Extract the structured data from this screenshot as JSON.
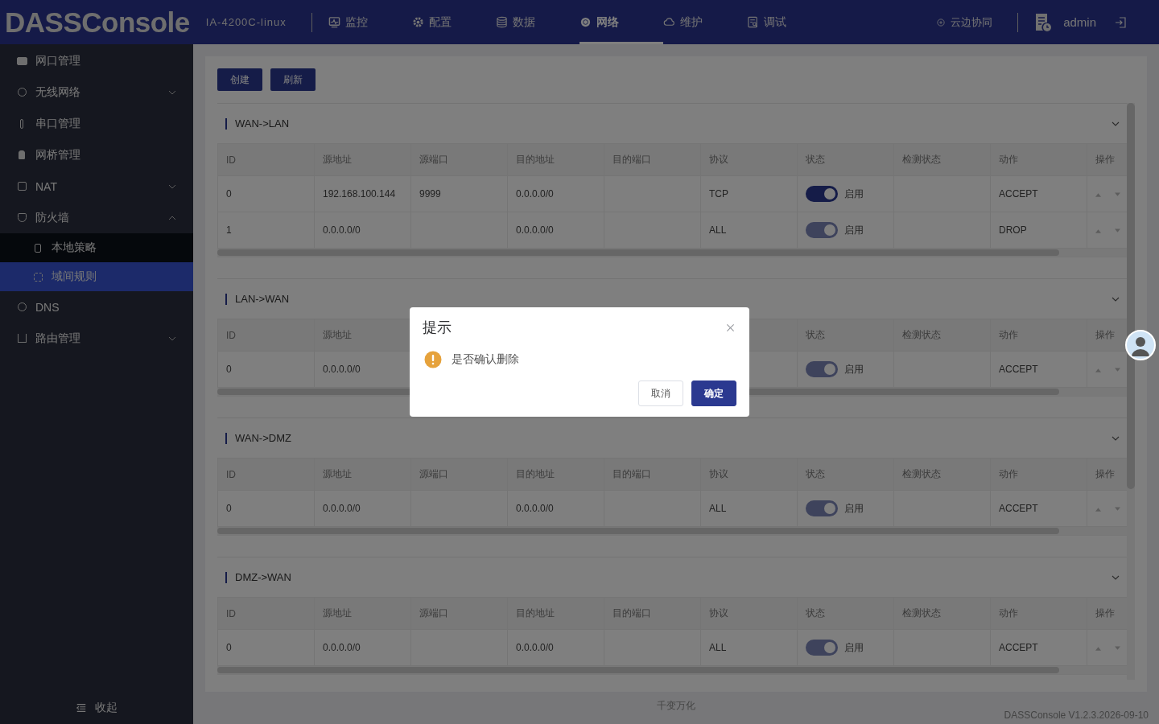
{
  "header": {
    "logo": "DASSConsole",
    "device": "IA-4200C-linux",
    "nav": [
      {
        "label": "监控",
        "selected": false
      },
      {
        "label": "配置",
        "selected": false
      },
      {
        "label": "数据",
        "selected": false
      },
      {
        "label": "网络",
        "selected": true
      },
      {
        "label": "维护",
        "selected": false
      },
      {
        "label": "调试",
        "selected": false
      }
    ],
    "cloud": "云边协同",
    "user": "admin"
  },
  "sidebar": {
    "items": [
      {
        "label": "网口管理",
        "selected": false
      },
      {
        "label": "无线网络",
        "selected": false,
        "expanded": false
      },
      {
        "label": "串口管理",
        "selected": false
      },
      {
        "label": "网桥管理",
        "selected": false
      },
      {
        "label": "NAT",
        "selected": false,
        "expanded": false
      },
      {
        "label": "防火墙",
        "selected": false,
        "expanded": true,
        "children": [
          {
            "label": "本地策略",
            "selected": false
          },
          {
            "label": "域间规则",
            "selected": true
          }
        ]
      },
      {
        "label": "DNS",
        "selected": false
      },
      {
        "label": "路由管理",
        "selected": false,
        "expanded": false
      }
    ],
    "collapse": "收起"
  },
  "toolbar": [
    "创建",
    "刷新"
  ],
  "sections": [
    {
      "title": "WAN->LAN",
      "expanded": true,
      "columns": [
        "ID",
        "源地址",
        "源端口",
        "目的地址",
        "目的端口",
        "协议",
        "状态",
        "检测状态",
        "动作",
        "操作"
      ],
      "rows": [
        {
          "id": "0",
          "src_addr": "192.168.100.144",
          "src_port": "9999",
          "dst_addr": "0.0.0.0/0",
          "protocol": "TCP",
          "status_on": true,
          "status_disabled": false,
          "status": "启用",
          "action": "ACCEPT"
        },
        {
          "id": "1",
          "src_addr": "0.0.0.0/0",
          "dst_addr": "0.0.0.0/0",
          "protocol": "ALL",
          "status_on": true,
          "status_disabled": true,
          "status": "启用",
          "action": "DROP"
        }
      ]
    },
    {
      "title": "LAN->WAN",
      "expanded": true,
      "columns": [
        "ID",
        "源地址",
        null,
        null,
        null,
        null,
        "状态",
        "检测状态",
        "动作",
        "操作"
      ],
      "rows": [
        {
          "id": "0",
          "src_addr": "0.0.0.0/0",
          "status_on": true,
          "status_disabled": true,
          "status": "启用",
          "action": "ACCEPT"
        }
      ]
    },
    {
      "title": "WAN->DMZ",
      "expanded": true,
      "columns": [
        "ID",
        "源地址",
        "源端口",
        "目的地址",
        "目的端口",
        "协议",
        "状态",
        "检测状态",
        "动作",
        "操作"
      ],
      "rows": [
        {
          "id": "0",
          "src_addr": "0.0.0.0/0",
          "dst_addr": "0.0.0.0/0",
          "protocol": "ALL",
          "status_on": true,
          "status_disabled": true,
          "status": "启用",
          "action": "ACCEPT"
        }
      ]
    },
    {
      "title": "DMZ->WAN",
      "expanded": true,
      "columns": [
        "ID",
        "源地址",
        "源端口",
        "目的地址",
        "目的端口",
        "协议",
        "状态",
        "检测状态",
        "动作",
        "操作"
      ],
      "rows": [
        {
          "id": "0",
          "src_addr": "0.0.0.0/0",
          "dst_addr": "0.0.0.0/0",
          "protocol": "ALL",
          "status_on": true,
          "status_disabled": true,
          "status": "启用",
          "action": "ACCEPT"
        }
      ]
    }
  ],
  "footer": {
    "slogan": "千变万化",
    "version": "DASSConsole V1.2.3.2026-09-10"
  },
  "dialog": {
    "title": "提示",
    "message": "是否确认删除",
    "buttons": [
      {
        "label": "取消",
        "kind": "default"
      },
      {
        "label": "确定",
        "kind": "primary"
      }
    ]
  }
}
